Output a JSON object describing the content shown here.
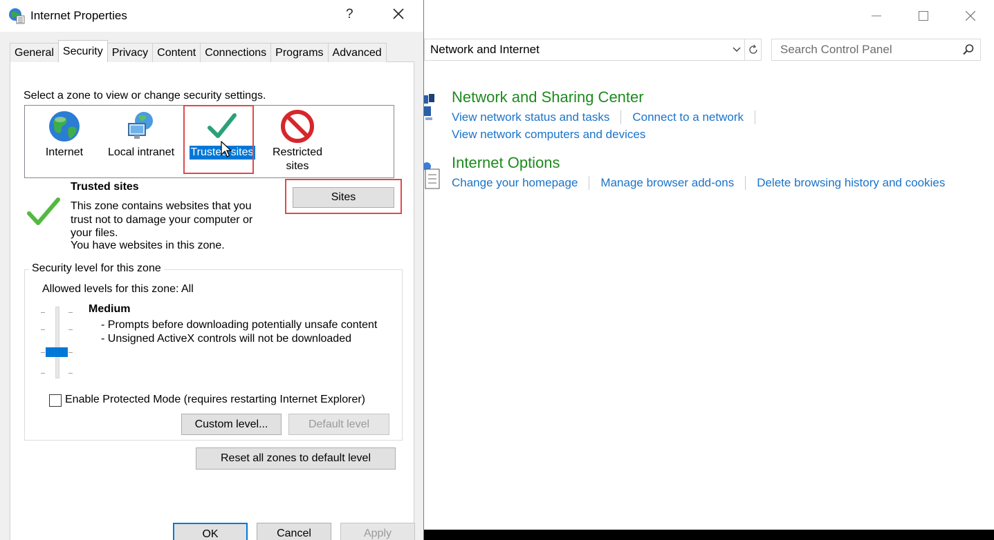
{
  "control_panel": {
    "window_buttons": {
      "minimize": "—",
      "maximize": "☐",
      "close": "✕"
    },
    "address": "Network and Internet",
    "search": {
      "placeholder": "Search Control Panel",
      "value": ""
    },
    "sections": [
      {
        "title": "Network and Sharing Center",
        "links": [
          "View network status and tasks",
          "Connect to a network",
          "View network computers and devices"
        ]
      },
      {
        "title": "Internet Options",
        "links": [
          "Change your homepage",
          "Manage browser add-ons",
          "Delete browsing history and cookies"
        ]
      }
    ],
    "colors": {
      "heading": "#1e8a1e",
      "link": "#1a73c9"
    }
  },
  "dialog": {
    "title": "Internet Properties",
    "help": "?",
    "tabs": [
      "General",
      "Security",
      "Privacy",
      "Content",
      "Connections",
      "Programs",
      "Advanced"
    ],
    "active_tab": "Security",
    "zone_prompt": "Select a zone to view or change security settings.",
    "zones": [
      {
        "label": "Internet",
        "icon": "globe-icon"
      },
      {
        "label": "Local intranet",
        "icon": "intranet-icon"
      },
      {
        "label": "Trusted sites",
        "icon": "checkmark-icon",
        "selected": true
      },
      {
        "label": "Restricted sites",
        "icon": "restricted-icon"
      }
    ],
    "zone_info": {
      "title": "Trusted sites",
      "description": "This zone contains websites that you trust not to damage your computer or your files.",
      "has_sites": "You have websites in this zone."
    },
    "sites_button": "Sites",
    "security_level": {
      "legend": "Security level for this zone",
      "allowed": "Allowed levels for this zone: All",
      "level": "Medium",
      "desc1": "- Prompts before downloading potentially unsafe content",
      "desc2": "- Unsigned ActiveX controls will not be downloaded",
      "slider_position": "3 of 5"
    },
    "protected_mode": {
      "label": "Enable Protected Mode (requires restarting Internet Explorer)",
      "checked": false
    },
    "custom_level": "Custom level...",
    "default_level": "Default level",
    "reset_all": "Reset all zones to default level",
    "ok": "OK",
    "cancel": "Cancel",
    "apply": "Apply",
    "colors": {
      "selection": "#0078d7",
      "highlight_box": "#e0484c"
    }
  }
}
